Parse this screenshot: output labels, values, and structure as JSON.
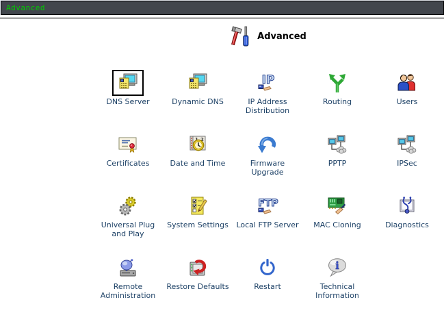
{
  "topbar": {
    "title": "Advanced",
    "bg_color": "#42464D",
    "text_color": "#00CC00"
  },
  "page": {
    "title": "Advanced",
    "title_icon": "tools-icon"
  },
  "colors": {
    "link_text": "#1D4166",
    "selected_border": "#000000",
    "divider": "#A6A6A6"
  },
  "grid": {
    "columns": 5,
    "items": [
      {
        "label": "DNS Server",
        "icon": "dns-server-icon",
        "selected": true
      },
      {
        "label": "Dynamic DNS",
        "icon": "dynamic-dns-icon",
        "selected": false
      },
      {
        "label": "IP Address Distribution",
        "icon": "ip-address-distribution-icon",
        "selected": false
      },
      {
        "label": "Routing",
        "icon": "routing-icon",
        "selected": false
      },
      {
        "label": "Users",
        "icon": "users-icon",
        "selected": false
      },
      {
        "label": "Certificates",
        "icon": "certificates-icon",
        "selected": false
      },
      {
        "label": "Date and Time",
        "icon": "date-and-time-icon",
        "selected": false
      },
      {
        "label": "Firmware Upgrade",
        "icon": "firmware-upgrade-icon",
        "selected": false
      },
      {
        "label": "PPTP",
        "icon": "pptp-icon",
        "selected": false
      },
      {
        "label": "IPSec",
        "icon": "ipsec-icon",
        "selected": false
      },
      {
        "label": "Universal Plug and Play",
        "icon": "upnp-icon",
        "selected": false
      },
      {
        "label": "System Settings",
        "icon": "system-settings-icon",
        "selected": false
      },
      {
        "label": "Local FTP Server",
        "icon": "local-ftp-server-icon",
        "selected": false
      },
      {
        "label": "MAC Cloning",
        "icon": "mac-cloning-icon",
        "selected": false
      },
      {
        "label": "Diagnostics",
        "icon": "diagnostics-icon",
        "selected": false
      },
      {
        "label": "Remote Administration",
        "icon": "remote-administration-icon",
        "selected": false
      },
      {
        "label": "Restore Defaults",
        "icon": "restore-defaults-icon",
        "selected": false
      },
      {
        "label": "Restart",
        "icon": "restart-icon",
        "selected": false
      },
      {
        "label": "Technical Information",
        "icon": "technical-information-icon",
        "selected": false
      }
    ]
  }
}
